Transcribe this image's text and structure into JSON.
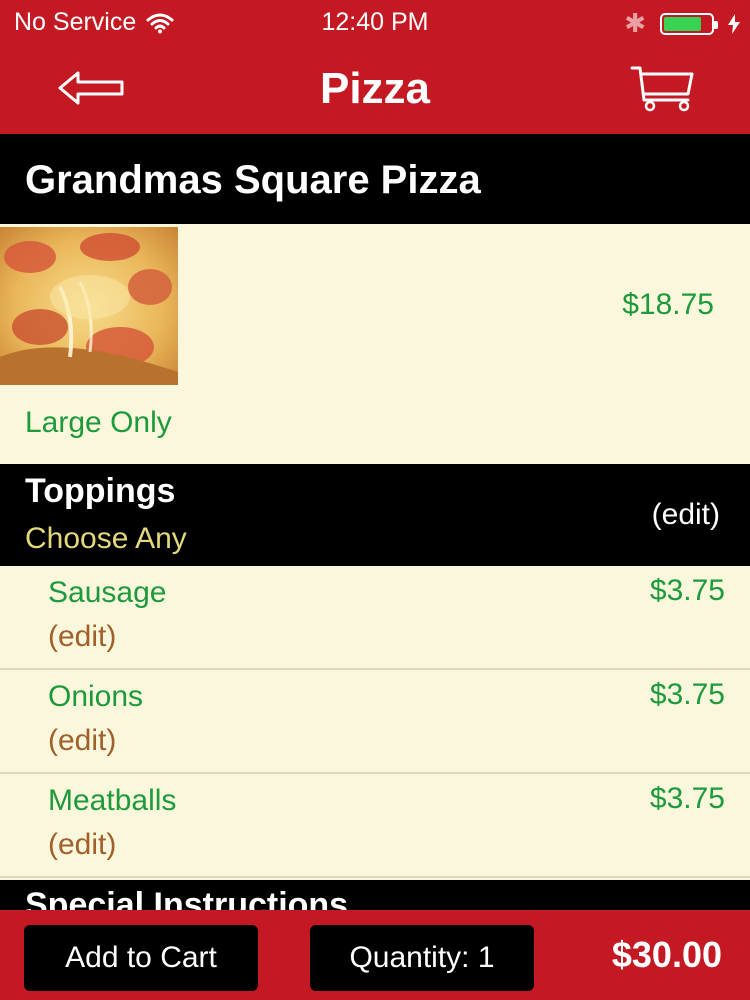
{
  "status_bar": {
    "carrier": "No Service",
    "time": "12:40 PM",
    "battery_level": 0.8,
    "colors": {
      "bar": "#c41923",
      "battery": "#39d353"
    }
  },
  "nav": {
    "title": "Pizza",
    "back_icon": "back-arrow-icon",
    "cart_icon": "cart-icon"
  },
  "item": {
    "name": "Grandmas Square Pizza",
    "price": "$18.75",
    "note": "Large Only",
    "image": "pizza-photo"
  },
  "toppings": {
    "title": "Toppings",
    "subtitle": "Choose Any",
    "edit_label": "(edit)",
    "items": [
      {
        "name": "Sausage",
        "price": "$3.75",
        "edit": "(edit)"
      },
      {
        "name": "Onions",
        "price": "$3.75",
        "edit": "(edit)"
      },
      {
        "name": "Meatballs",
        "price": "$3.75",
        "edit": "(edit)"
      }
    ]
  },
  "special_instructions": {
    "title": "Special Instructions"
  },
  "footer": {
    "add_to_cart": "Add to Cart",
    "quantity": "Quantity: 1",
    "total": "$30.00"
  },
  "colors": {
    "brand_red": "#c41923",
    "price_green": "#1d9a3c",
    "edit_brown": "#a0602a",
    "background": "#fbf7dc"
  }
}
